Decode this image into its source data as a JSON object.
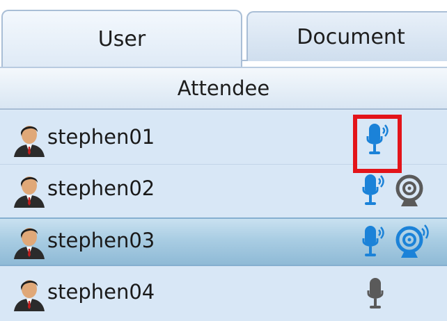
{
  "tabs": [
    {
      "label": "User",
      "active": true
    },
    {
      "label": "Document",
      "active": false
    }
  ],
  "list": {
    "header": "Attendee",
    "rows": [
      {
        "username": "stephen01",
        "mic": "mic-active-icon",
        "camera": null,
        "selected": false,
        "highlighted": true
      },
      {
        "username": "stephen02",
        "mic": "mic-active-icon",
        "camera": "webcam-inactive-icon",
        "selected": false,
        "highlighted": false
      },
      {
        "username": "stephen03",
        "mic": "mic-active-icon",
        "camera": "webcam-active-icon",
        "selected": true,
        "highlighted": false
      },
      {
        "username": "stephen04",
        "mic": "mic-inactive-icon",
        "camera": null,
        "selected": false,
        "highlighted": false
      }
    ]
  },
  "colors": {
    "active_blue": "#1b82d8",
    "inactive_gray": "#5a5a5a",
    "highlight_red": "#e3141a",
    "selected_row": "#a9cde3"
  }
}
